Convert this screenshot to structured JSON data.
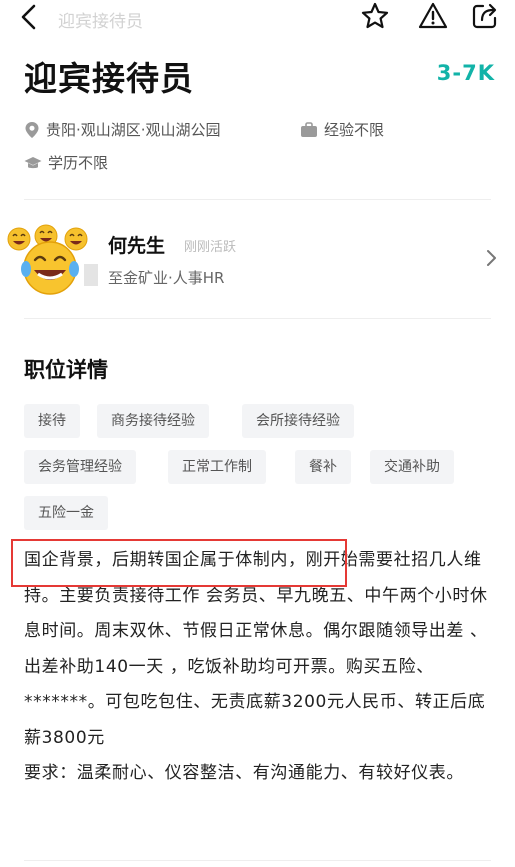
{
  "header": {
    "nav_title": "迎宾接待员",
    "back_icon": "chevron-left-icon",
    "favorite_icon": "star-icon",
    "report_icon": "warning-icon",
    "share_icon": "share-icon"
  },
  "job": {
    "title": "迎宾接待员",
    "salary": "3-7K",
    "location": "贵阳·观山湖区·观山湖公园",
    "experience": "经验不限",
    "education": "学历不限"
  },
  "recruiter": {
    "name": "何先生",
    "status": "刚刚活跃",
    "company": "至金矿业·人事HR"
  },
  "details": {
    "section_title": "职位详情",
    "tags": [
      "接待",
      "商务接待经验",
      "会所接待经验",
      "会务管理经验",
      "正常工作制",
      "餐补",
      "交通补助",
      "五险一金"
    ],
    "highlighted_text": "国企背景，后期转国企属于体制内，",
    "paragraph1_rest": "刚开始需要社招几人维持。主要负责接待工作 会务员、早九晚五、中午两个小时休息时间。周末双休、节假日正常休息。偶尔跟随领导出差 、出差补助140一天 ，吃饭补助均可开票。购买五险、*******。可包吃包住、无责底薪3200元人民币、转正后底薪3800元",
    "paragraph2": "要求：温柔耐心、仪容整洁、有沟通能力、有较好仪表。"
  },
  "colors": {
    "accent": "#12b3a8",
    "highlight_border": "#e53935",
    "tag_bg": "#f3f4f6"
  }
}
